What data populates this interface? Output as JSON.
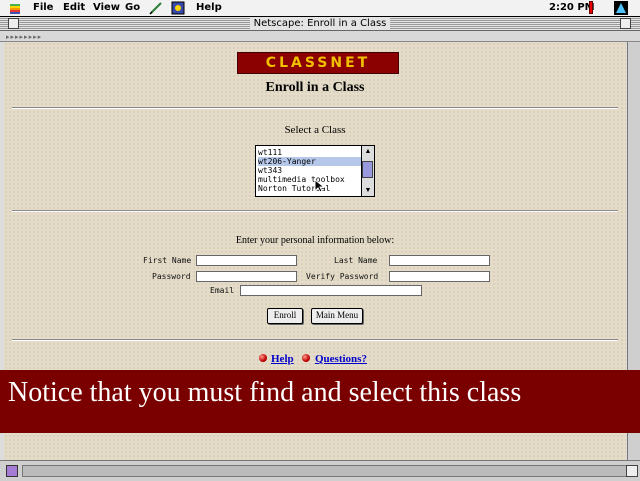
{
  "menubar": {
    "items": [
      "File",
      "Edit",
      "View",
      "Go",
      "Help"
    ],
    "clock": "2:20 PM"
  },
  "window": {
    "title": "Netscape: Enroll in a Class"
  },
  "page": {
    "logo_text": "CLASSNET",
    "heading": "Enroll in a Class",
    "select_heading": "Select a Class",
    "class_options": [
      "wt111",
      "wt206-Yanger",
      "wt343",
      "multimedia toolbox",
      "Norton Tutorial"
    ],
    "selected_index": 1,
    "info_prompt": "Enter your personal information below:",
    "fields": {
      "first_name": {
        "label": "First Name",
        "value": ""
      },
      "last_name": {
        "label": "Last Name",
        "value": ""
      },
      "password": {
        "label": "Password",
        "value": ""
      },
      "verify_password": {
        "label": "Verify Password",
        "value": ""
      },
      "email": {
        "label": "Email",
        "value": ""
      }
    },
    "buttons": {
      "enroll": "Enroll",
      "main_menu": "Main Menu"
    },
    "links": {
      "help": "Help",
      "questions": "Questions?"
    }
  },
  "caption": "Notice that you must find and select this class",
  "colors": {
    "page_background": "#e4dcc8",
    "caption_background": "#7a0000",
    "logo_background": "#8b0000",
    "logo_text": "#f0c000",
    "link": "#0000cc",
    "selected_option": "#b6c8ea"
  }
}
